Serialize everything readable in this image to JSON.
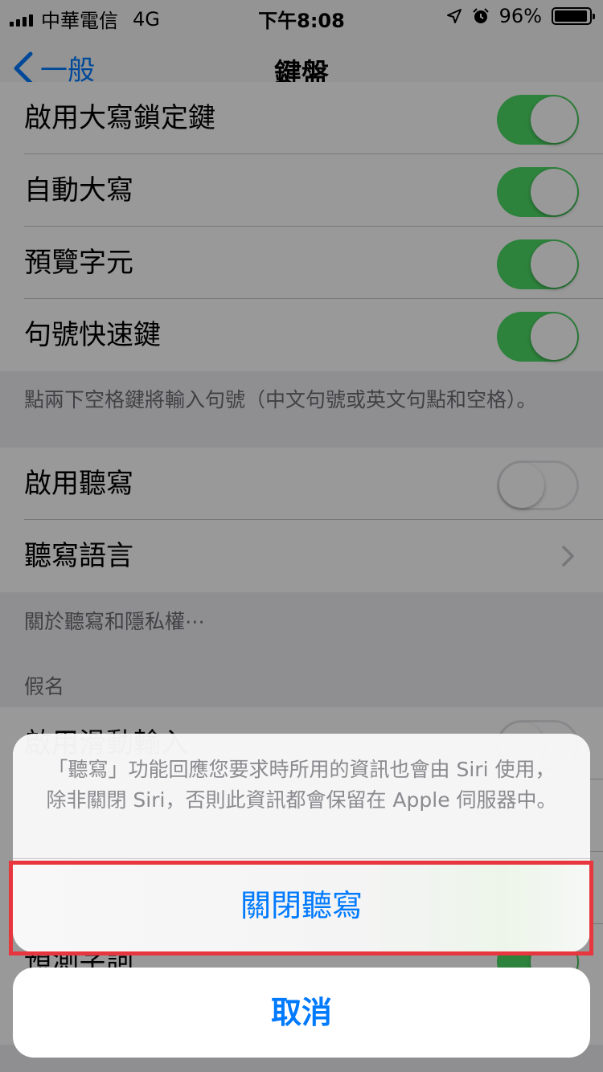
{
  "status_bar": {
    "carrier": "中華電信",
    "network": "4G",
    "time": "下午8:08",
    "battery": "96%",
    "battery_level": 0.96
  },
  "nav": {
    "back_label": "一般",
    "title": "鍵盤"
  },
  "settings": {
    "caps_lock": {
      "label": "啟用大寫鎖定鍵",
      "on": true
    },
    "auto_caps": {
      "label": "自動大寫",
      "on": true
    },
    "char_preview": {
      "label": "預覽字元",
      "on": true
    },
    "period_shortcut": {
      "label": "句號快速鍵",
      "on": true
    },
    "period_footer": "點兩下空格鍵將輸入句號（中文句號或英文句點和空格）。",
    "enable_dictation": {
      "label": "啟用聽寫",
      "on": false
    },
    "dictation_language": {
      "label": "聽寫語言"
    },
    "dictation_footer": "關於聽寫和隱私權⋯",
    "kana_header": "假名",
    "kana_row": {
      "label": "啟用滑動輸入",
      "on": false
    },
    "predictive_row": {
      "label": "預測字詞",
      "on": true
    }
  },
  "action_sheet": {
    "message": "「聽寫」功能回應您要求時所用的資訊也會由 Siri 使用，除非關閉 Siri，否則此資訊都會保留在 Apple 伺服器中。",
    "action_label": "關閉聽寫",
    "cancel_label": "取消"
  },
  "colors": {
    "accent": "#007aff",
    "toggle_on": "#4cd964",
    "highlight": "#e8363e"
  }
}
